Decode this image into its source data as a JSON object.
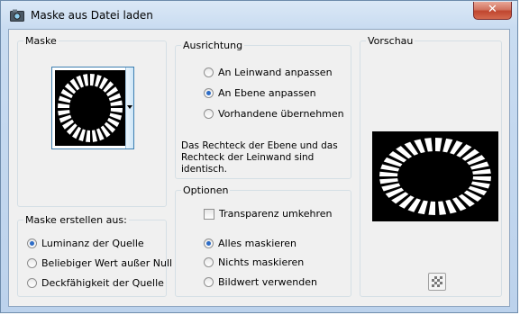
{
  "window": {
    "title": "Maske aus Datei laden",
    "close_label": "✕"
  },
  "maske": {
    "title": "Maske"
  },
  "erstellen": {
    "title": "Maske erstellen aus:",
    "options": [
      "Luminanz der Quelle",
      "Beliebiger Wert außer Null",
      "Deckfähigkeit der Quelle"
    ],
    "selected": "Luminanz der Quelle"
  },
  "ausrichtung": {
    "title": "Ausrichtung",
    "options": [
      "An Leinwand anpassen",
      "An Ebene anpassen",
      "Vorhandene übernehmen"
    ],
    "selected": "An Ebene anpassen",
    "info": "Das Rechteck der Ebene und das Rechteck der Leinwand sind identisch."
  },
  "optionen": {
    "title": "Optionen",
    "invert_label": "Transparenz umkehren",
    "invert_checked": false,
    "options": [
      "Alles maskieren",
      "Nichts maskieren",
      "Bildwert verwenden"
    ],
    "selected": "Alles maskieren"
  },
  "vorschau": {
    "title": "Vorschau"
  },
  "icons": {
    "app": "image-mask-icon",
    "thumb_dropdown": "chevron-down-icon",
    "checkerboard": "checkerboard-icon"
  },
  "colors": {
    "radio_selected": "#2d6cc6",
    "preview_bg": "#000000",
    "close_button": "#c0462f"
  }
}
